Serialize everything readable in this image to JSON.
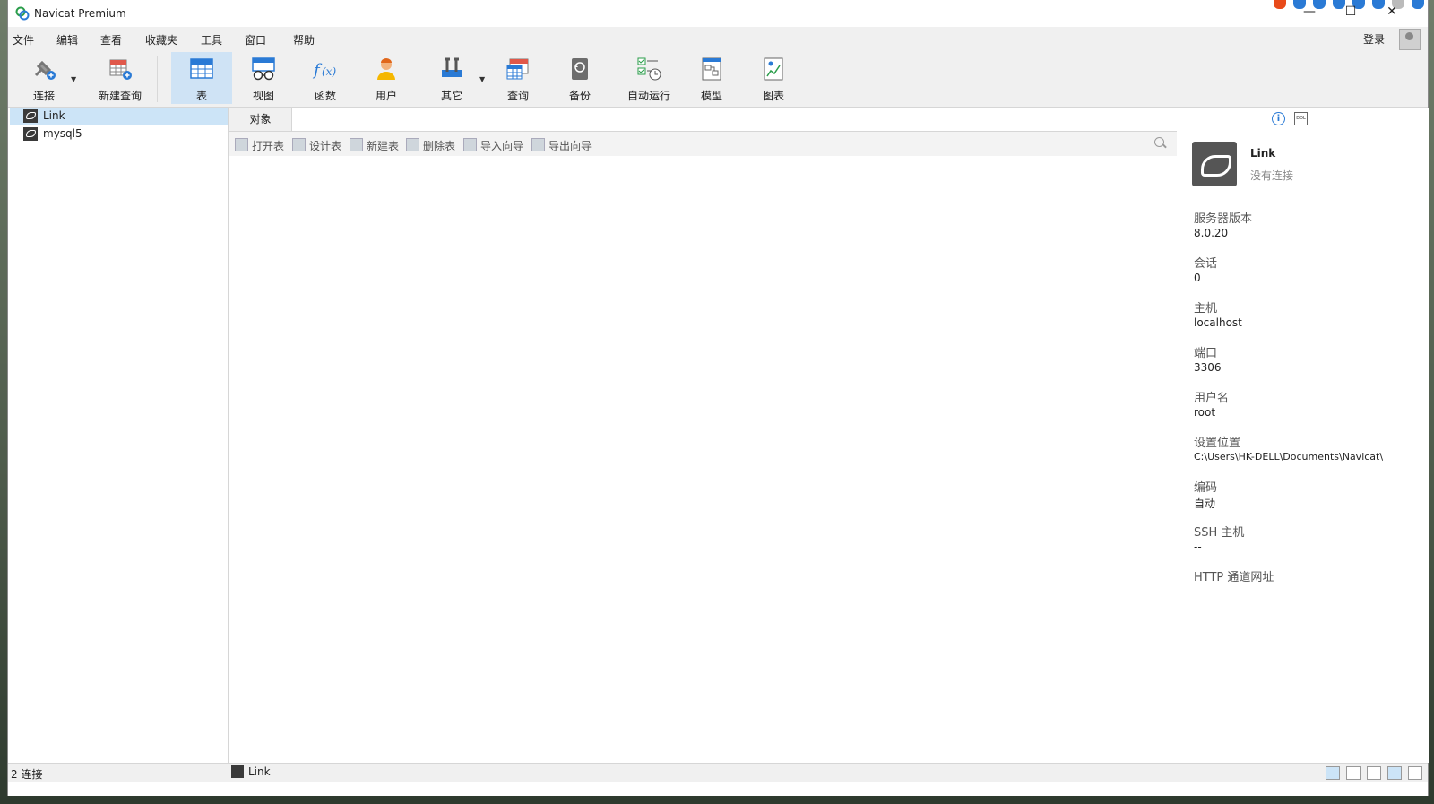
{
  "window": {
    "title": "Navicat Premium"
  },
  "menu": [
    "文件",
    "编辑",
    "查看",
    "收藏夹",
    "工具",
    "窗口",
    "帮助"
  ],
  "login": "登录",
  "toolbar": [
    {
      "label": "连接",
      "icon": "plug-connect-icon"
    },
    {
      "label": "新建查询",
      "icon": "new-query-icon"
    },
    {
      "label": "表",
      "icon": "table-icon",
      "active": true
    },
    {
      "label": "视图",
      "icon": "view-glasses-icon"
    },
    {
      "label": "函数",
      "icon": "function-fx-icon"
    },
    {
      "label": "用户",
      "icon": "user-icon"
    },
    {
      "label": "其它",
      "icon": "tools-icon"
    },
    {
      "label": "查询",
      "icon": "query-icon"
    },
    {
      "label": "备份",
      "icon": "backup-icon"
    },
    {
      "label": "自动运行",
      "icon": "auto-run-icon"
    },
    {
      "label": "模型",
      "icon": "model-icon"
    },
    {
      "label": "图表",
      "icon": "chart-icon"
    }
  ],
  "connections": [
    {
      "name": "Link",
      "selected": true
    },
    {
      "name": "mysql5",
      "selected": false
    }
  ],
  "object_tab": "对象",
  "object_actions": [
    "打开表",
    "设计表",
    "新建表",
    "删除表",
    "导入向导",
    "导出向导"
  ],
  "info": {
    "name": "Link",
    "state": "没有连接",
    "props": [
      {
        "k": "服务器版本",
        "v": "8.0.20"
      },
      {
        "k": "会话",
        "v": "0"
      },
      {
        "k": "主机",
        "v": "localhost"
      },
      {
        "k": "端口",
        "v": "3306"
      },
      {
        "k": "用户名",
        "v": "root"
      },
      {
        "k": "设置位置",
        "v": "C:\\Users\\HK-DELL\\Documents\\Navicat\\"
      },
      {
        "k": "编码",
        "v": "自动"
      },
      {
        "k": "SSH 主机",
        "v": "--"
      },
      {
        "k": "HTTP 通道网址",
        "v": "--"
      }
    ]
  },
  "status": {
    "count": "2 连接",
    "current": "Link"
  },
  "colors": {
    "selection": "#cce4f7",
    "toolbar_bg": "#f0f0f0",
    "info_accent": "#2a7ad5"
  }
}
